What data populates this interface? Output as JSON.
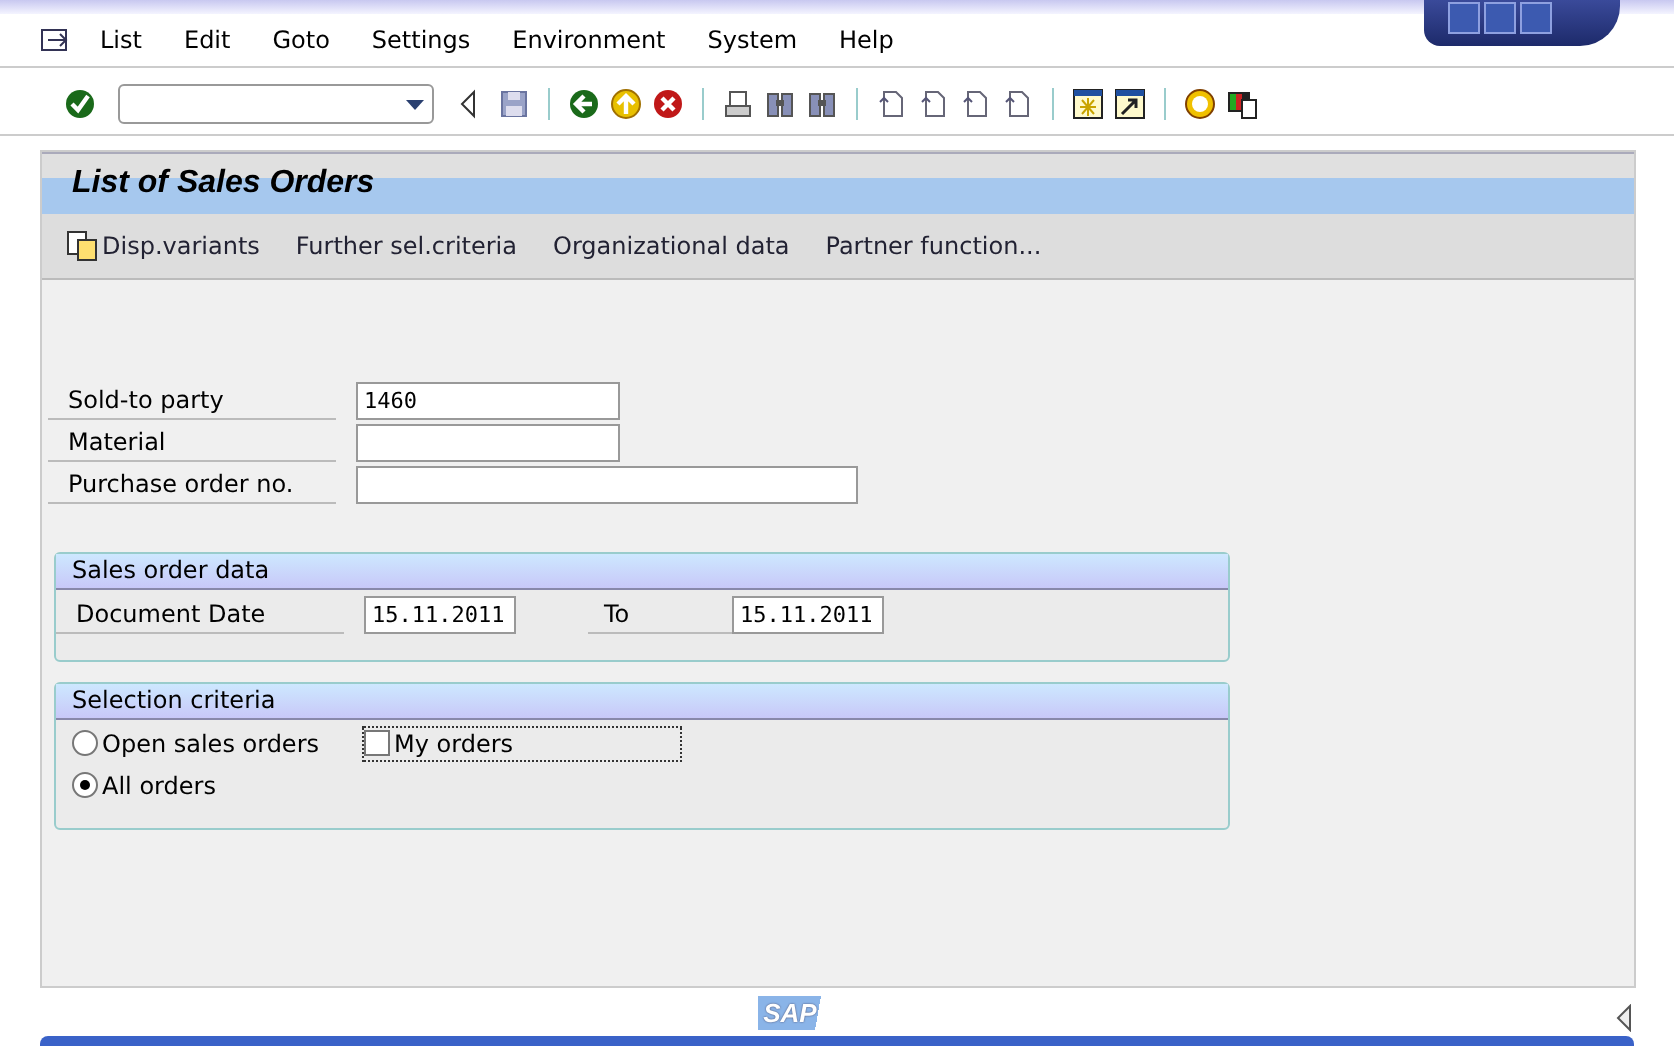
{
  "menu": [
    {
      "label": "List"
    },
    {
      "label": "Edit"
    },
    {
      "label": "Goto"
    },
    {
      "label": "Settings"
    },
    {
      "label": "Environment"
    },
    {
      "label": "System"
    },
    {
      "label": "Help"
    }
  ],
  "title": "List of Sales Orders",
  "app_toolbar": [
    {
      "kind": "icon",
      "label": "Disp.variants"
    },
    {
      "kind": "text",
      "label": "Further sel.criteria"
    },
    {
      "kind": "text",
      "label": "Organizational data"
    },
    {
      "kind": "text",
      "label": "Partner function..."
    }
  ],
  "fields": [
    {
      "kind": "short",
      "label": "Sold-to party",
      "value": "1460"
    },
    {
      "kind": "short",
      "label": "Material"
    },
    {
      "kind": "long",
      "label": "Purchase order no."
    }
  ],
  "groups": [
    {
      "title": "Sales order data",
      "rows": [
        {
          "kind": "range",
          "label": "Document Date",
          "from": "15.11.2011",
          "to_label": "To",
          "to": "15.11.2011"
        }
      ]
    },
    {
      "title": "Selection criteria",
      "rows": [
        {
          "kind": "radio",
          "label": "Open sales orders",
          "selected": false,
          "checkbox": {
            "label": "My orders",
            "checked": false
          }
        },
        {
          "kind": "radio",
          "label": "All orders",
          "selected": true
        }
      ]
    }
  ],
  "footer": {
    "logo": "SAP"
  }
}
